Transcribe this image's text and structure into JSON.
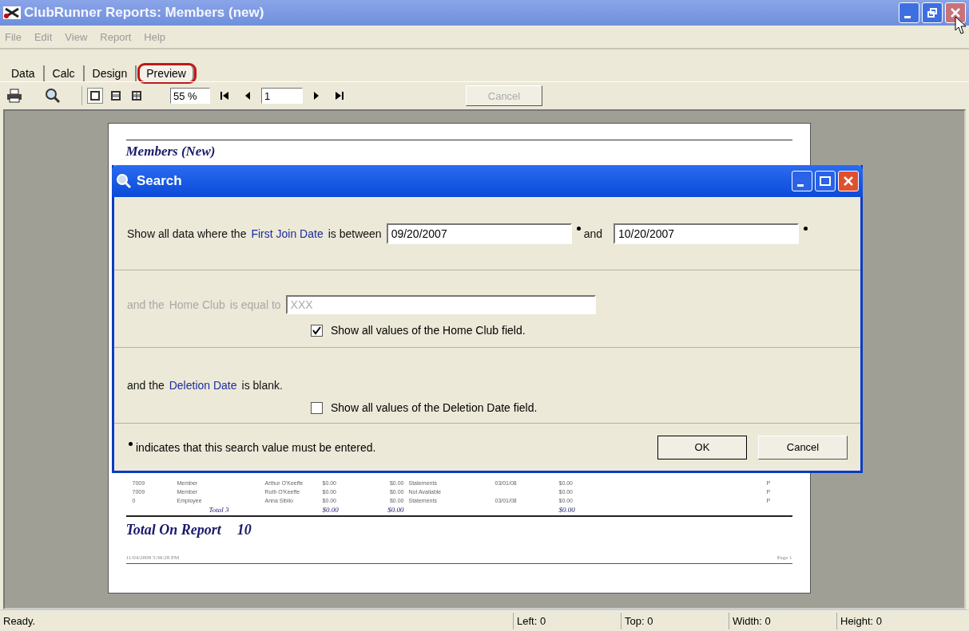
{
  "window": {
    "title": "ClubRunner Reports: Members (new)"
  },
  "menu": [
    "File",
    "Edit",
    "View",
    "Report",
    "Help"
  ],
  "tabs": [
    {
      "label": "Data",
      "selected": false
    },
    {
      "label": "Calc",
      "selected": false
    },
    {
      "label": "Design",
      "selected": false
    },
    {
      "label": "Preview",
      "selected": true
    }
  ],
  "toolbar": {
    "view_modes": [
      {
        "selected": true
      },
      {
        "selected": false
      },
      {
        "selected": false
      }
    ],
    "zoom": "55 %",
    "page": "1",
    "cancel": {
      "label": "Cancel",
      "disabled": true
    }
  },
  "report": {
    "title": "Members (New)",
    "rows": [
      [
        "7009",
        "Member",
        "Arthur O'Keeffe",
        "$0.00",
        "$0.00",
        "Statements",
        "03/01/08",
        "$0.00",
        "P"
      ],
      [
        "7009",
        "Member",
        "Ruth O'Keeffe",
        "$0.00",
        "$0.00",
        "Not Available",
        "",
        "$0.00",
        "P"
      ],
      [
        "0",
        "Employee",
        "Anna Sibilo",
        "$0.00",
        "$0.00",
        "Statements",
        "03/01/08",
        "$0.00",
        "P"
      ]
    ],
    "subtotal": {
      "label": "Total 3",
      "values": [
        "$0.00",
        "$0.00",
        "$0.00"
      ]
    },
    "total": {
      "label": "Total On Report",
      "value": "10"
    },
    "footer": {
      "printed": "11/04/2008 5:36:28 PM",
      "page": "Page 1"
    }
  },
  "dialog": {
    "title": "Search",
    "sections": [
      {
        "kind": "range",
        "disabled": false,
        "parts": [
          {
            "kind": "plain",
            "text": "Show all data where the"
          },
          {
            "kind": "field",
            "text": "First Join Date"
          },
          {
            "kind": "plain",
            "text": "is between"
          }
        ],
        "value": "09/20/2007",
        "joiner": "and",
        "value2": "10/20/2007",
        "required": true
      },
      {
        "kind": "equal",
        "disabled": true,
        "parts": [
          {
            "kind": "plain",
            "text": "and the"
          },
          {
            "kind": "plain",
            "text": "Home Club"
          },
          {
            "kind": "plain",
            "text": "is equal to"
          }
        ],
        "value": "XXX",
        "checkbox": {
          "label": "Show all values of the Home Club field.",
          "checked": true
        }
      },
      {
        "kind": "blank",
        "disabled": false,
        "parts": [
          {
            "kind": "plain",
            "text": "and the"
          },
          {
            "kind": "field",
            "text": "Deletion Date"
          },
          {
            "kind": "plain",
            "text": "is blank."
          }
        ],
        "checkbox": {
          "label": "Show all values of the Deletion Date field.",
          "checked": false
        }
      }
    ],
    "note": "indicates that this search value must be entered.",
    "buttons": [
      "OK",
      "Cancel"
    ]
  },
  "status_bar": [
    "Ready.",
    "Left: 0",
    "Top: 0",
    "Width: 0",
    "Height: 0"
  ]
}
